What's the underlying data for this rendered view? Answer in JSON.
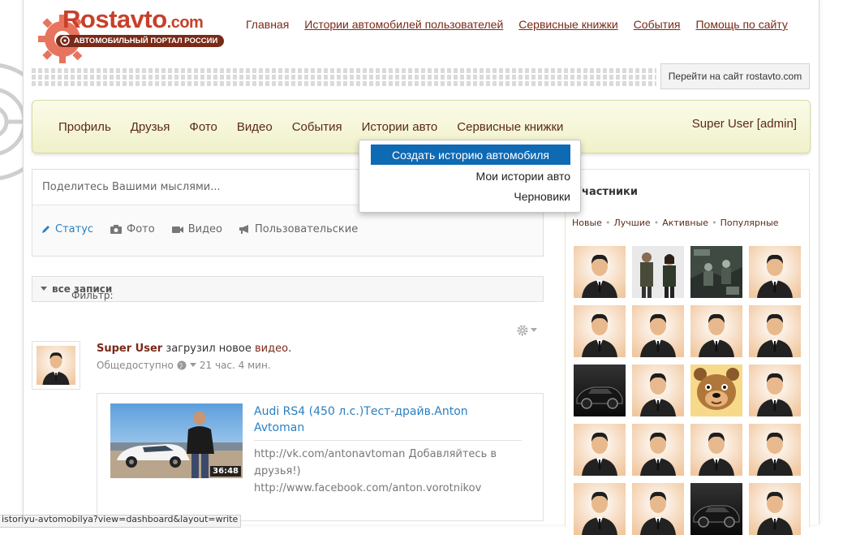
{
  "logo": {
    "brand": "Rostavto",
    "domain": ".com",
    "slogan": "АВТОМОБИЛЬНЫЙ ПОРТАЛ РОССИИ"
  },
  "topnav": [
    {
      "label": "Главная"
    },
    {
      "label": "Истории автомобилей пользователей"
    },
    {
      "label": "Сервисные книжки"
    },
    {
      "label": "События"
    },
    {
      "label": "Помощь по сайту"
    }
  ],
  "goto_button": "Перейти на сайт rostavto.com",
  "mainnav": {
    "items": [
      {
        "label": "Профиль"
      },
      {
        "label": "Друзья"
      },
      {
        "label": "Фото"
      },
      {
        "label": "Видео"
      },
      {
        "label": "События"
      },
      {
        "label": "Истории авто"
      },
      {
        "label": "Сервисные книжки"
      }
    ],
    "user": "Super User [admin]"
  },
  "dropdown": {
    "items": [
      {
        "label": "Создать историю автомобиля"
      },
      {
        "label": "Мои истории авто"
      },
      {
        "label": "Черновики"
      }
    ]
  },
  "share": {
    "placeholder": "Поделитесь Вашими мыслями...",
    "tabs": [
      {
        "label": "Статус"
      },
      {
        "label": "Фото"
      },
      {
        "label": "Видео"
      },
      {
        "label": "Пользовательские"
      }
    ]
  },
  "filter": {
    "prefix": "Фильтр: ",
    "value": "все записи"
  },
  "post": {
    "user": "Super User",
    "action": " загрузил новое ",
    "object": "видео",
    "end": ".",
    "privacy": "Общедоступно",
    "time": "21 час. 4 мин.",
    "video": {
      "title": "Audi RS4 (450 л.с.)Тест-драйв.Anton Avtoman",
      "duration": "36:48",
      "desc_line1": "http://vk.com/antonavtoman Добавляйтесь в друзья!)",
      "desc_line2": "http://www.facebook.com/anton.vorotnikov"
    }
  },
  "sidebar": {
    "title": "Участники",
    "filters": [
      {
        "label": "Новые"
      },
      {
        "label": "Лучшие"
      },
      {
        "label": "Активные"
      },
      {
        "label": "Популярные"
      }
    ],
    "members": [
      "default",
      "photo-soldiers",
      "photo-game",
      "default",
      "default",
      "default",
      "default",
      "default",
      "photo-car-dark",
      "default",
      "photo-cartoon-bear",
      "default",
      "default",
      "default",
      "default",
      "default",
      "default",
      "default",
      "photo-car-dark",
      "default"
    ]
  },
  "statusbar": "istoriyu-avtomobilya?view=dashboard&layout=write",
  "colors": {
    "brand_red": "#c7402a",
    "brand_brown": "#7a2a18",
    "link_blue": "#2a7fc0",
    "dropdown_active": "#0f6ab4",
    "nav_bg": "#f0f1c9"
  }
}
